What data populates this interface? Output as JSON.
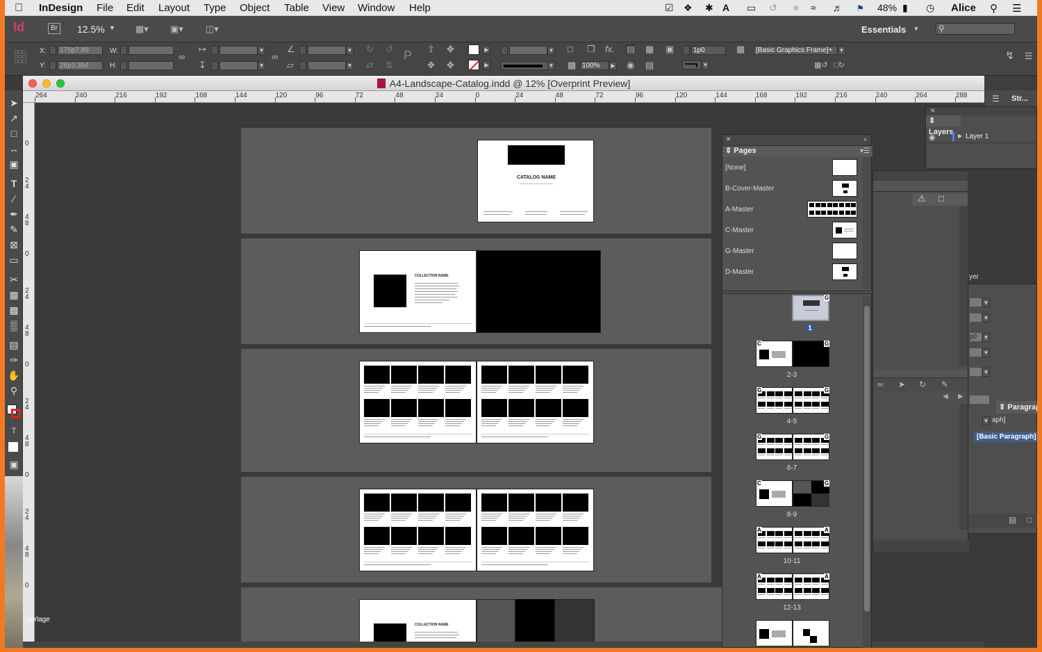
{
  "menubar": {
    "app": "InDesign",
    "items": [
      "File",
      "Edit",
      "Layout",
      "Type",
      "Object",
      "Table",
      "View",
      "Window",
      "Help"
    ],
    "battery": "48%",
    "user": "Alice"
  },
  "control": {
    "zoom": "12.5%",
    "workspace": "Essentials",
    "x_label": "X:",
    "x_value": "175p7.89",
    "y_label": "Y:",
    "y_value": "26p3.354",
    "w_label": "W:",
    "h_label": "H:",
    "stroke_weight": "1p0",
    "opacity": "100%",
    "object_style": "[Basic Graphics Frame]+"
  },
  "document": {
    "title": "A4-Landscape-Catalog.indd @ 12% [Overprint Preview]",
    "ruler_ticks": [
      "264",
      "240",
      "216",
      "192",
      "168",
      "144",
      "120",
      "96",
      "72",
      "48",
      "24",
      "0",
      "24",
      "48",
      "72",
      "96",
      "120",
      "144",
      "168",
      "192",
      "216",
      "240",
      "264",
      "288"
    ],
    "vruler_ticks": [
      "0",
      "2\n4",
      "4\n8",
      "0",
      "2\n4",
      "4\n8",
      "0",
      "2\n4",
      "4\n8",
      "0",
      "2\n4",
      "4\n8",
      "0"
    ],
    "catalog_name": "CATALOG NAME",
    "collection_name": "COLLECTION NAME"
  },
  "pages_panel": {
    "tab": "Pages",
    "masters": [
      "[None]",
      "B-Cover-Master",
      "A-Master",
      "C-Master",
      "G-Master",
      "D-Master"
    ],
    "page_labels": [
      "1",
      "2-3",
      "4-5",
      "6-7",
      "8-9",
      "10-11",
      "12-13"
    ]
  },
  "layers_panel": {
    "tab": "Layers",
    "layer": "Layer 1"
  },
  "side_panels": {
    "stroke_tab": "Str...",
    "paragraph_tab": "Paragrap",
    "paragraph_style_partial": "aph]",
    "paragraph_style": "[Basic Paragraph]",
    "layer_partial": "yer",
    "field_partial": "p0"
  },
  "sidebar_caption": "vorlage"
}
